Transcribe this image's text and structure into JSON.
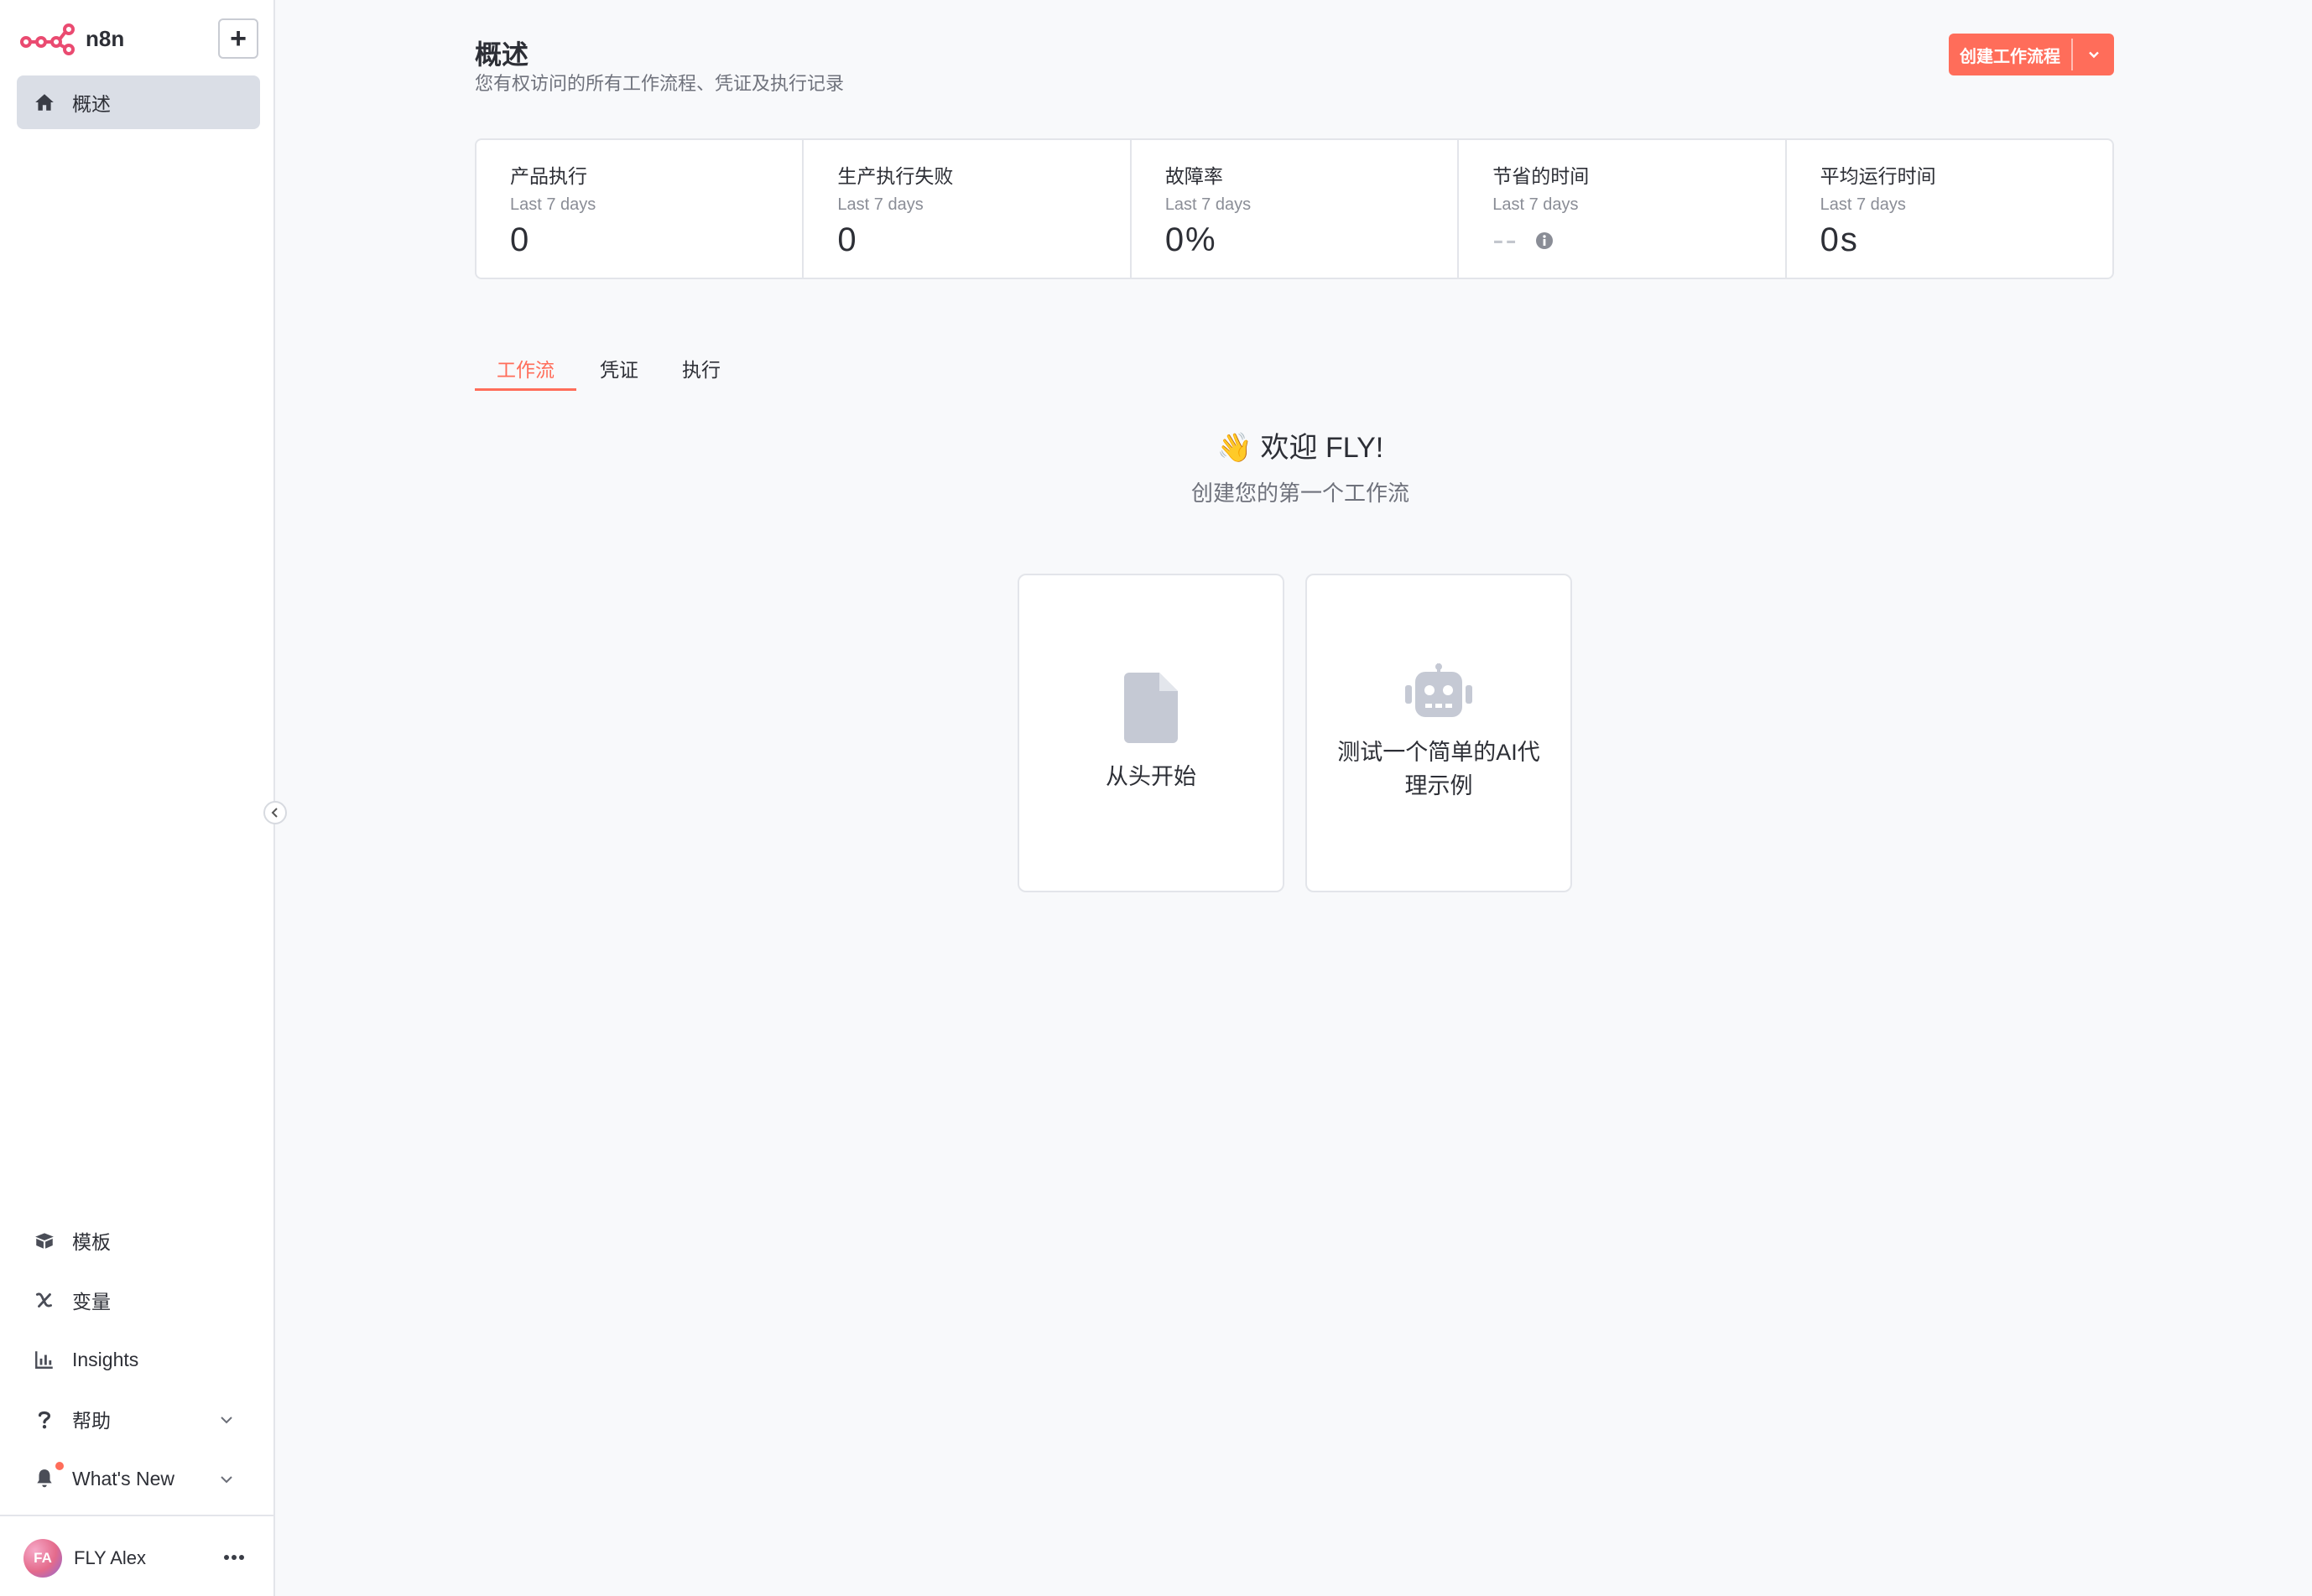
{
  "app": {
    "name": "n8n",
    "brand_color": "#ea4b71",
    "accent": "#ff6d5a"
  },
  "sidebar": {
    "add_label": "+",
    "top_items": [
      {
        "label": "概述",
        "icon": "home-icon",
        "active": true
      }
    ],
    "bottom_items": [
      {
        "label": "模板",
        "icon": "box-icon"
      },
      {
        "label": "变量",
        "icon": "variable-icon"
      },
      {
        "label": "Insights",
        "icon": "bar-chart-icon"
      },
      {
        "label": "帮助",
        "icon": "question-icon"
      },
      {
        "label": "What's New",
        "icon": "bell-icon"
      }
    ],
    "user": {
      "initials": "FA",
      "name": "FLY Alex"
    }
  },
  "header": {
    "title": "概述",
    "subtitle": "您有权访问的所有工作流程、凭证及执行记录",
    "create_button": "创建工作流程"
  },
  "stats": [
    {
      "label": "产品执行",
      "period": "Last 7 days",
      "value": "0"
    },
    {
      "label": "生产执行失败",
      "period": "Last 7 days",
      "value": "0"
    },
    {
      "label": "故障率",
      "period": "Last 7 days",
      "value": "0%"
    },
    {
      "label": "节省的时间",
      "period": "Last 7 days",
      "value": "--"
    },
    {
      "label": "平均运行时间",
      "period": "Last 7 days",
      "value": "0s"
    }
  ],
  "tabs": [
    {
      "label": "工作流",
      "active": true
    },
    {
      "label": "凭证",
      "active": false
    },
    {
      "label": "执行",
      "active": false
    }
  ],
  "welcome": {
    "title": "👋 欢迎 FLY!",
    "subtitle": "创建您的第一个工作流"
  },
  "cards": [
    {
      "label": "从头开始",
      "icon": "file-icon"
    },
    {
      "label": "测试一个简单的AI代理示例",
      "icon": "robot-icon"
    }
  ]
}
